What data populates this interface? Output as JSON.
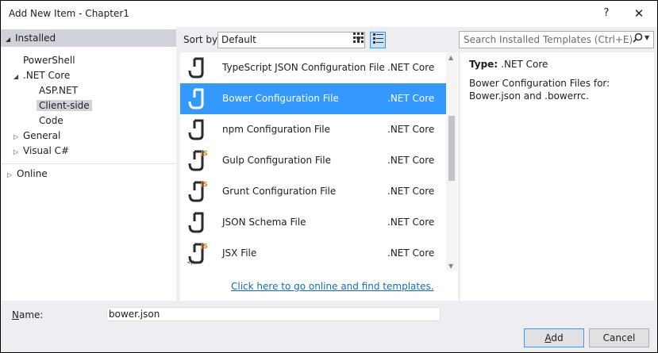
{
  "window": {
    "title": "Add New Item - Chapter1",
    "help_label": "?",
    "close_label": "✕"
  },
  "tree": {
    "installed": "Installed",
    "powershell": "PowerShell",
    "net_core": ".NET Core",
    "aspnet": "ASP.NET",
    "client_side": "Client-side",
    "code": "Code",
    "general": "General",
    "visual_cs": "Visual C#",
    "online": "Online"
  },
  "sort": {
    "label": "Sort by:",
    "value": "Default"
  },
  "search": {
    "placeholder": "Search Installed Templates (Ctrl+E)"
  },
  "items": [
    {
      "name": "TypeScript JSON Configuration File",
      "category": ".NET Core",
      "icon": "json-file-icon",
      "js": false
    },
    {
      "name": "Bower Configuration File",
      "category": ".NET Core",
      "icon": "json-file-icon",
      "js": false
    },
    {
      "name": "npm Configuration File",
      "category": ".NET Core",
      "icon": "json-file-icon",
      "js": false
    },
    {
      "name": "Gulp Configuration File",
      "category": ".NET Core",
      "icon": "js-file-icon",
      "js": true
    },
    {
      "name": "Grunt Configuration File",
      "category": ".NET Core",
      "icon": "js-file-icon",
      "js": true
    },
    {
      "name": "JSON Schema File",
      "category": ".NET Core",
      "icon": "json-file-icon",
      "js": false
    },
    {
      "name": "JSX File",
      "category": ".NET Core",
      "icon": "jsx-file-icon",
      "js": true
    }
  ],
  "selected_index": 1,
  "online_link": "Click here to go online and find templates.",
  "details": {
    "type_label": "Type:",
    "type_value": ".NET Core",
    "description": "Bower Configuration Files for: Bower.json and .bowerrc."
  },
  "name_field": {
    "label": "Name:",
    "value": "bower.json"
  },
  "buttons": {
    "add": "Add",
    "cancel": "Cancel"
  },
  "colors": {
    "selection": "#3399ff",
    "link": "#0e70c0",
    "tree_highlight": "#cfd2d8"
  }
}
